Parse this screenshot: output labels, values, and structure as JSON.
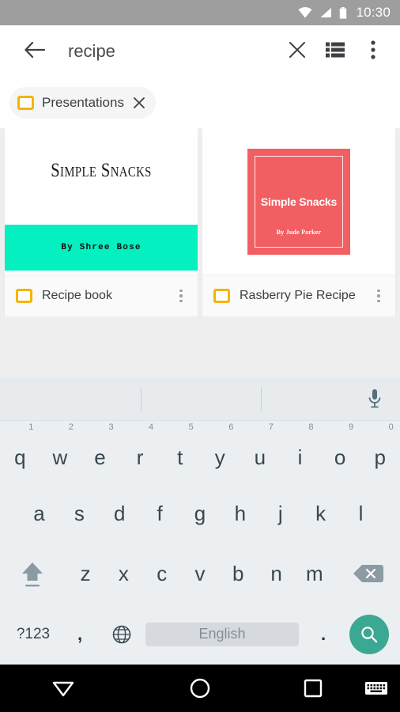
{
  "status_bar": {
    "time": "10:30",
    "icons": [
      "wifi-icon",
      "signal-icon",
      "battery-icon"
    ],
    "background_color": "#9e9e9e"
  },
  "appbar": {
    "back_icon": "arrow-back-icon",
    "query": "recipe",
    "clear_icon": "close-icon",
    "view_toggle_icon": "list-view-icon",
    "overflow_icon": "more-vert-icon"
  },
  "filter_chip": {
    "icon": "slides-icon",
    "label": "Presentations",
    "remove_icon": "close-icon"
  },
  "results": [
    {
      "title": "Recipe book",
      "icon": "slides-icon",
      "menu_icon": "more-vert-icon",
      "thumbnail": {
        "style": "white-with-band",
        "title": "Simple Snacks",
        "author": "By Shree Bose",
        "band_color": "#05f0c0"
      }
    },
    {
      "title": "Rasberry Pie Recipe",
      "icon": "slides-icon",
      "menu_icon": "more-vert-icon",
      "thumbnail": {
        "style": "red-square",
        "title": "Simple Snacks",
        "author": "By Jude Parker",
        "fill_color": "#f15f63"
      }
    }
  ],
  "keyboard": {
    "mic_icon": "microphone-icon",
    "row1": [
      {
        "letter": "q",
        "num": "1"
      },
      {
        "letter": "w",
        "num": "2"
      },
      {
        "letter": "e",
        "num": "3"
      },
      {
        "letter": "r",
        "num": "4"
      },
      {
        "letter": "t",
        "num": "5"
      },
      {
        "letter": "y",
        "num": "6"
      },
      {
        "letter": "u",
        "num": "7"
      },
      {
        "letter": "i",
        "num": "8"
      },
      {
        "letter": "o",
        "num": "9"
      },
      {
        "letter": "p",
        "num": "0"
      }
    ],
    "row2": [
      {
        "letter": "a"
      },
      {
        "letter": "s"
      },
      {
        "letter": "d"
      },
      {
        "letter": "f"
      },
      {
        "letter": "g"
      },
      {
        "letter": "h"
      },
      {
        "letter": "j"
      },
      {
        "letter": "k"
      },
      {
        "letter": "l"
      }
    ],
    "row3": [
      {
        "letter": "z"
      },
      {
        "letter": "x"
      },
      {
        "letter": "c"
      },
      {
        "letter": "v"
      },
      {
        "letter": "b"
      },
      {
        "letter": "n"
      },
      {
        "letter": "m"
      }
    ],
    "shift_icon": "shift-icon",
    "backspace_icon": "backspace-icon",
    "symbols_label": "?123",
    "comma_label": ",",
    "globe_icon": "language-globe-icon",
    "spacebar_label": "English",
    "period_label": ".",
    "search_icon": "search-icon",
    "search_key_color": "#3aa893"
  },
  "navbar": {
    "back_icon": "triangle-down-icon",
    "home_icon": "circle-icon",
    "recents_icon": "square-icon",
    "keyboard_icon": "keyboard-icon"
  }
}
